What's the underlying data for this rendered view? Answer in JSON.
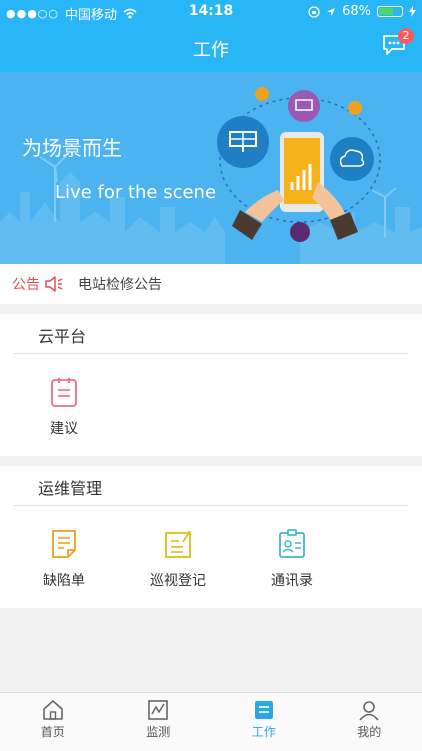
{
  "status_bar": {
    "carrier": "中国移动",
    "time": "14:18",
    "battery": "68%",
    "battery_level": 0.68
  },
  "header": {
    "title": "工作",
    "message_badge": "2"
  },
  "banner": {
    "title_cn": "为场景而生",
    "title_en": "Live for the scene"
  },
  "notice": {
    "label": "公告",
    "text": "电站检修公告"
  },
  "sections": [
    {
      "title": "云平台",
      "items": [
        {
          "label": "建议",
          "icon": "suggestion-icon"
        }
      ]
    },
    {
      "title": "运维管理",
      "items": [
        {
          "label": "缺陷单",
          "icon": "defect-form-icon"
        },
        {
          "label": "巡视登记",
          "icon": "inspection-icon"
        },
        {
          "label": "通讯录",
          "icon": "contacts-icon"
        }
      ]
    }
  ],
  "tabs": [
    {
      "label": "首页",
      "icon": "home-icon"
    },
    {
      "label": "监测",
      "icon": "monitor-icon"
    },
    {
      "label": "工作",
      "icon": "work-icon",
      "active": true
    },
    {
      "label": "我的",
      "icon": "profile-icon"
    }
  ],
  "colors": {
    "primary": "#29b6f6",
    "active_tab": "#29a8e8",
    "notice_label": "#e05050"
  }
}
